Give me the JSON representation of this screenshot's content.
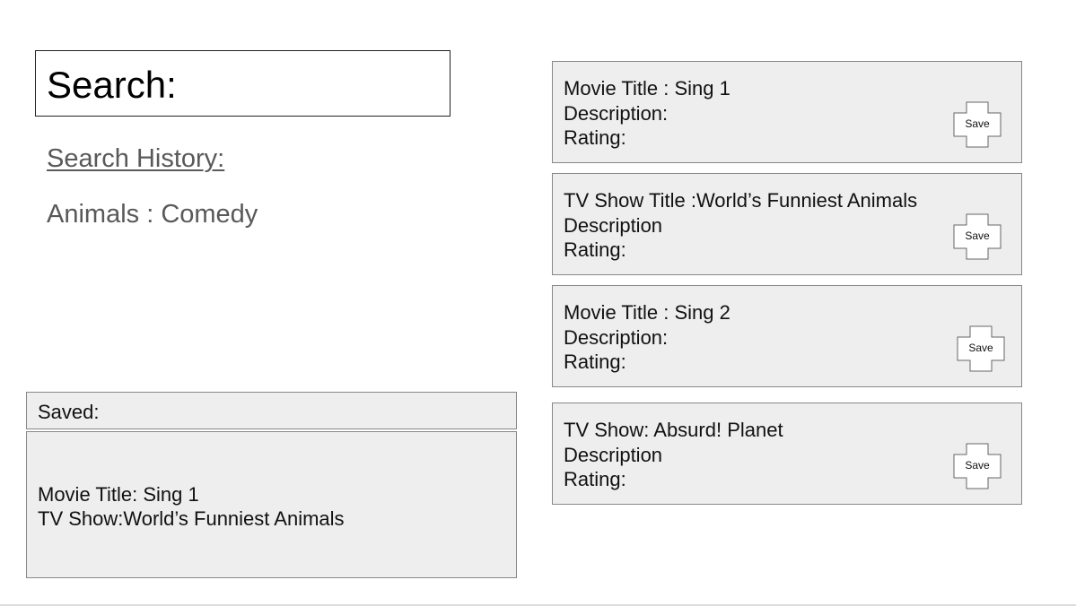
{
  "search": {
    "label": "Search:"
  },
  "history": {
    "title": "Search History:",
    "items": [
      "Animals : Comedy"
    ]
  },
  "saved": {
    "title": "Saved:",
    "items": [
      "Movie Title: Sing 1",
      "TV Show:World’s Funniest Animals"
    ]
  },
  "results": [
    {
      "title": "Movie Title : Sing 1",
      "description": "Description:",
      "rating": "Rating:",
      "save_label": "Save"
    },
    {
      "title": "TV Show Title :World’s Funniest Animals",
      "description": "Description",
      "rating": "Rating:",
      "save_label": "Save"
    },
    {
      "title": "Movie Title : Sing 2",
      "description": "Description:",
      "rating": "Rating:",
      "save_label": "Save"
    },
    {
      "title": "TV Show: Absurd! Planet",
      "description": "Description",
      "rating": "Rating:",
      "save_label": "Save"
    }
  ]
}
